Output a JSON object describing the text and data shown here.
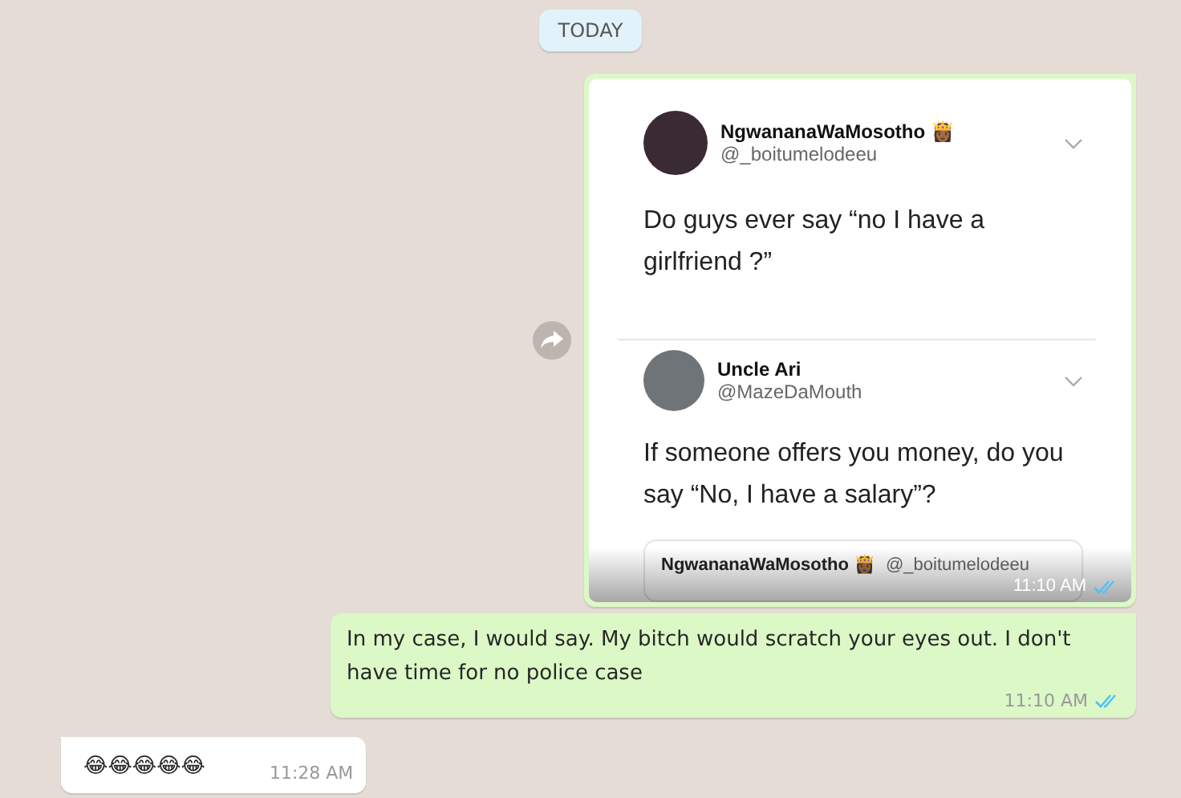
{
  "date_divider": "TODAY",
  "messages": [
    {
      "kind": "image",
      "outgoing": true,
      "forwardable": true,
      "time": "11:10 AM",
      "read": true,
      "image": {
        "tweets": [
          {
            "name": "NgwananaWaMosotho 👸🏾",
            "handle": "@_boitumelodeeu",
            "text": "Do guys ever say “no I have a girlfriend ?”"
          },
          {
            "name": "Uncle Ari",
            "handle": "@MazeDaMouth",
            "text": "If someone offers you money, do you say “No, I have a salary”?"
          }
        ],
        "quote": {
          "name": "NgwananaWaMosotho 👸🏾",
          "handle": "@_boitumelodeeu"
        }
      }
    },
    {
      "kind": "text",
      "outgoing": true,
      "text": "In my case, I would say. My bitch would scratch your eyes out. I don't have time for no police case",
      "time": "11:10 AM",
      "read": true
    },
    {
      "kind": "text",
      "outgoing": false,
      "text": "😂😂😂😂😂",
      "time": "11:28 AM"
    }
  ]
}
